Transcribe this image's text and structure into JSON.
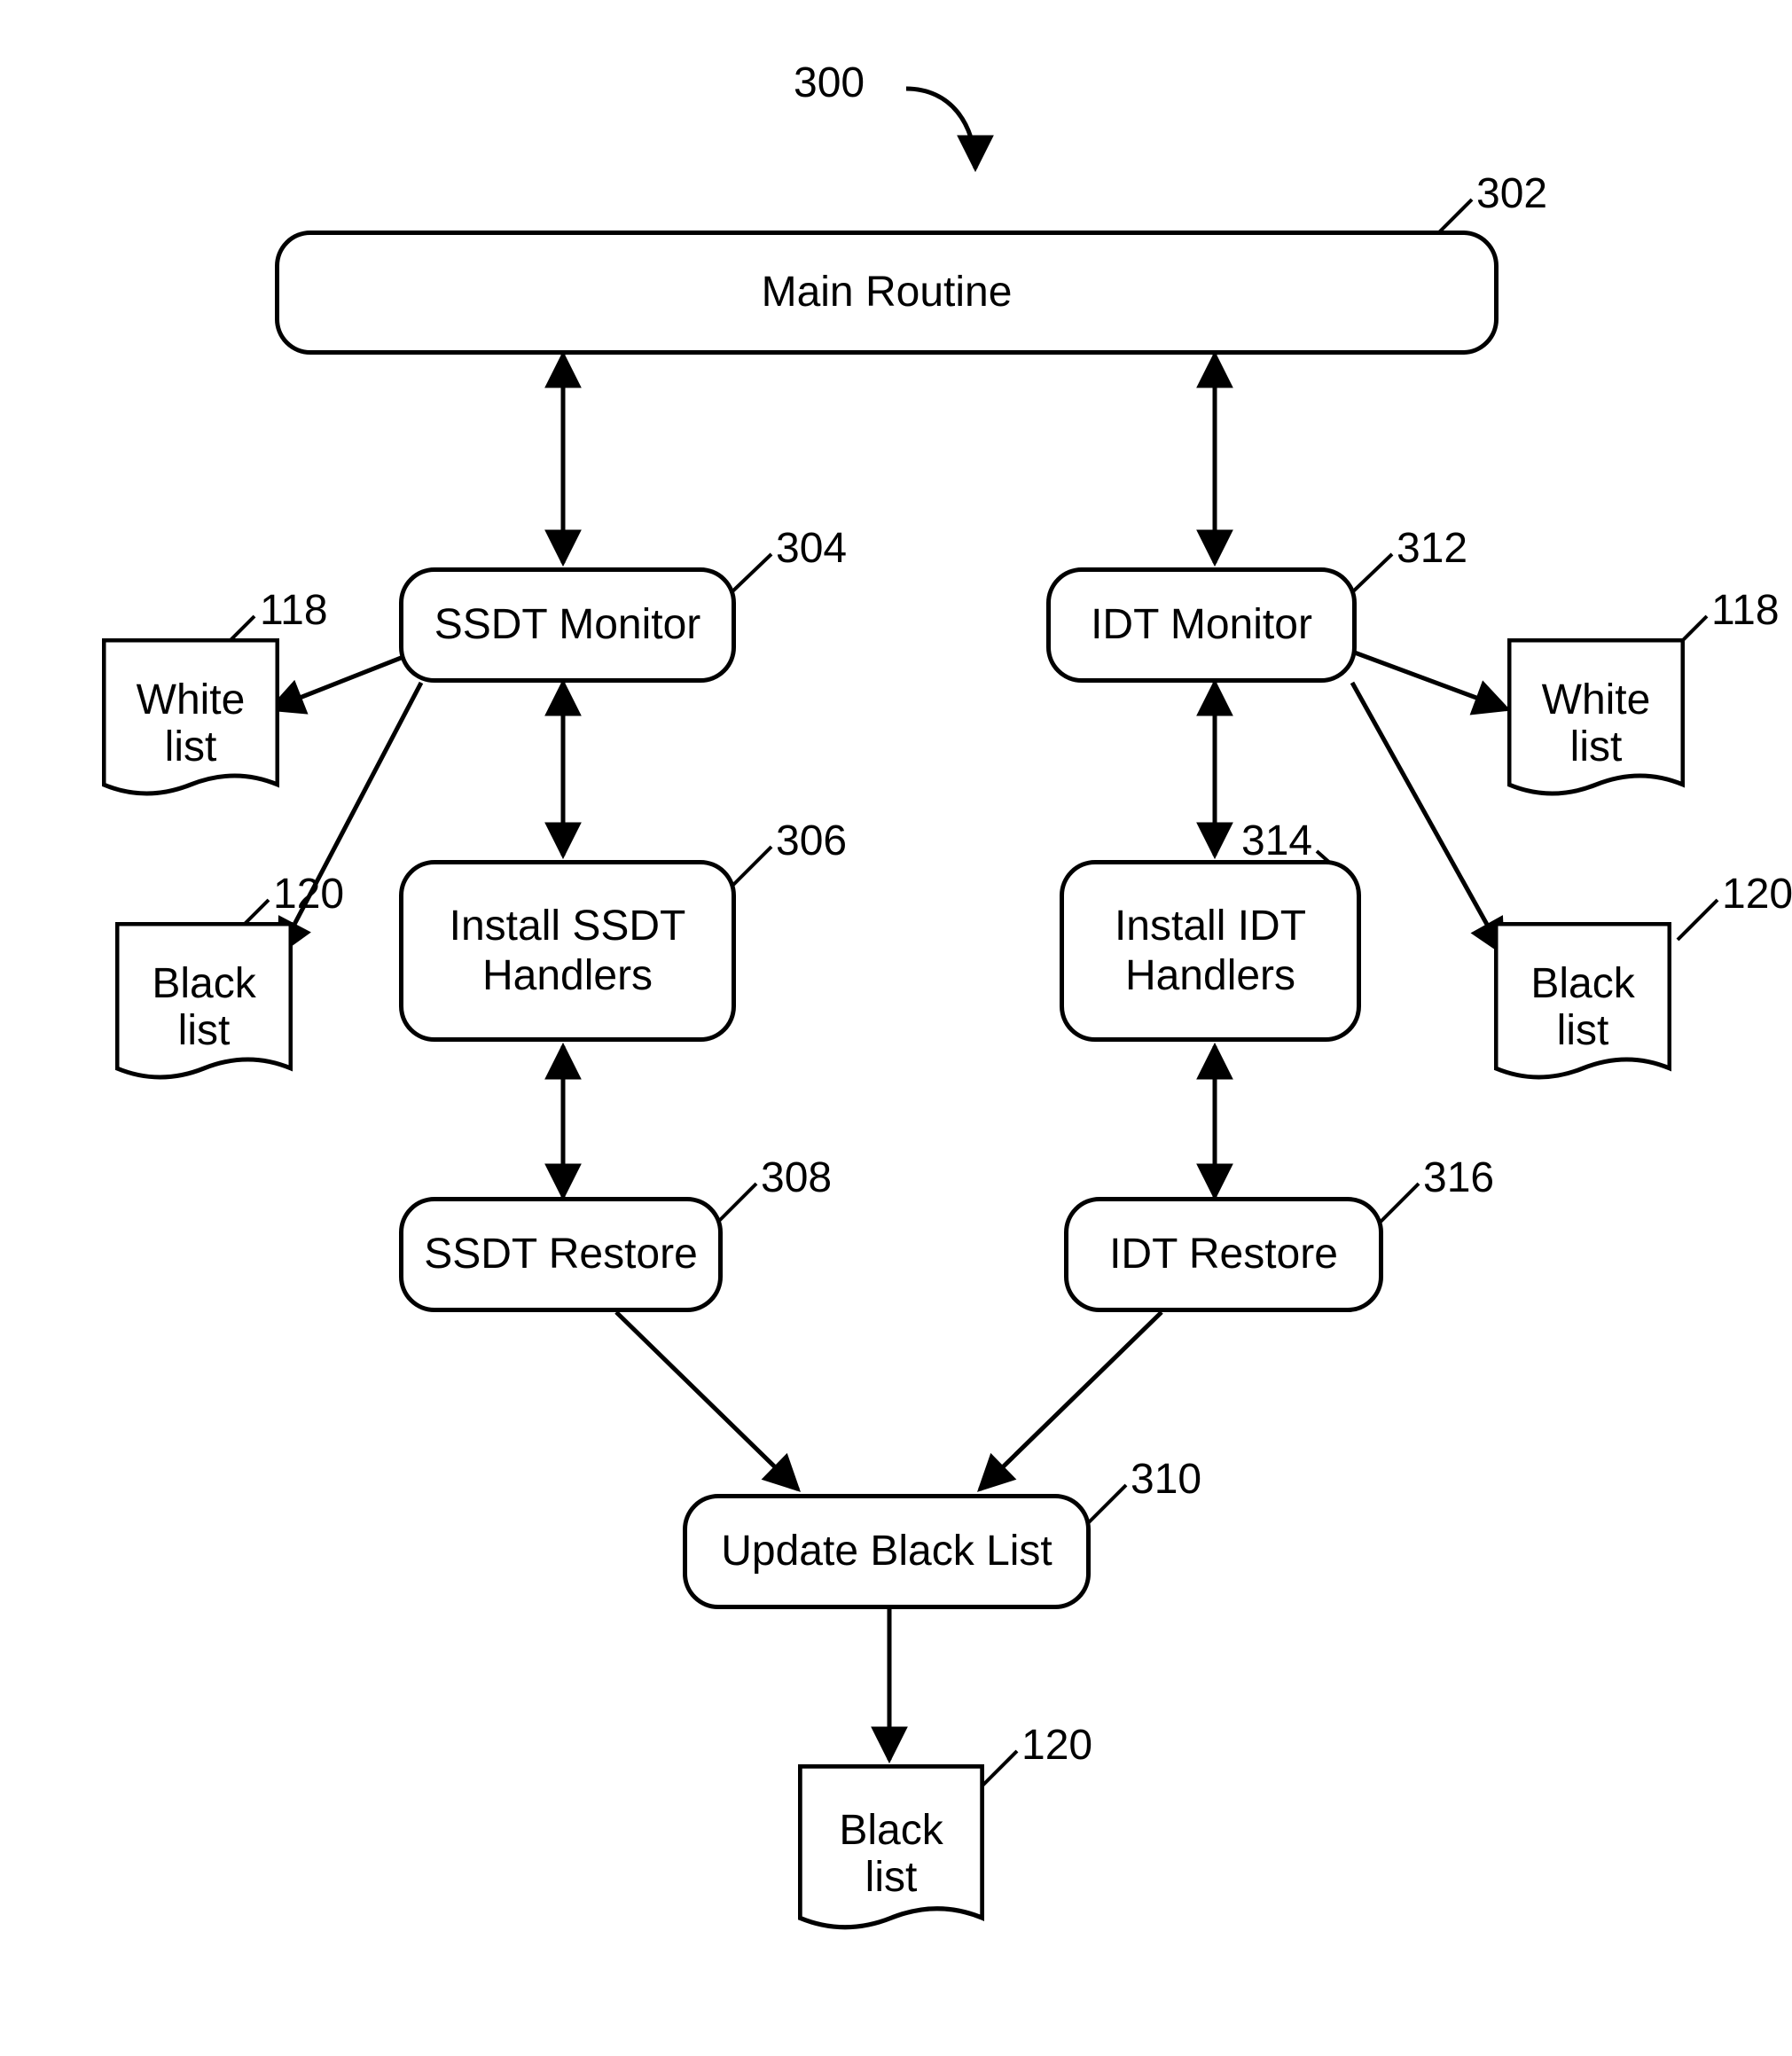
{
  "figure_ref": "300",
  "boxes": {
    "main_routine": {
      "label": "Main Routine",
      "ref": "302"
    },
    "ssdt_monitor": {
      "label": "SSDT Monitor",
      "ref": "304"
    },
    "install_ssdt": {
      "label": "Install SSDT\nHandlers",
      "ref": "306"
    },
    "ssdt_restore": {
      "label": "SSDT Restore",
      "ref": "308"
    },
    "idt_monitor": {
      "label": "IDT Monitor",
      "ref": "312"
    },
    "install_idt": {
      "label": "Install IDT\nHandlers",
      "ref": "314"
    },
    "idt_restore": {
      "label": "IDT Restore",
      "ref": "316"
    },
    "update_black": {
      "label": "Update Black List",
      "ref": "310"
    }
  },
  "docs": {
    "white_list": {
      "label": "White\nlist",
      "ref": "118"
    },
    "black_list": {
      "label": "Black\nlist",
      "ref": "120"
    }
  }
}
